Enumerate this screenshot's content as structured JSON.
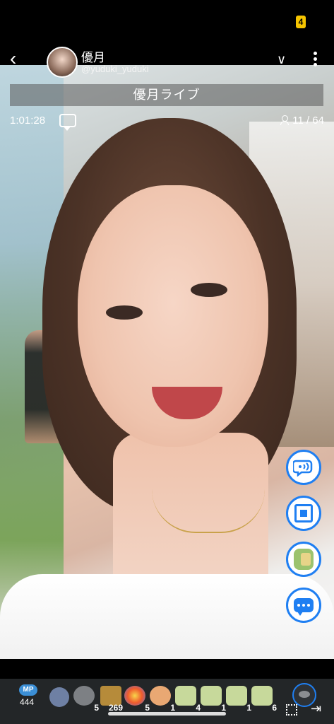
{
  "host": {
    "name": "優月",
    "id": "@yuduki_yuduki"
  },
  "stream": {
    "title": "優月ライブ",
    "elapsed": "1:01:28",
    "viewers": "11 / 64"
  },
  "status": {
    "battery": "4"
  },
  "mp": {
    "label": "MP",
    "value": "444"
  },
  "items": [
    {
      "name": "stone-gift-icon",
      "count": "5"
    },
    {
      "name": "yen-gift-icon",
      "count": "269"
    },
    {
      "name": "firework-gift-icon",
      "count": "5"
    },
    {
      "name": "clap-gift-icon",
      "count": "1"
    },
    {
      "name": "green-gift-10-icon",
      "count": "4"
    },
    {
      "name": "green-gift-icon",
      "count": "1"
    },
    {
      "name": "green-gift-100-icon",
      "count": "1"
    },
    {
      "name": "green-gift-30-icon",
      "count": "6"
    }
  ],
  "icons": {
    "back": "chevron-left-icon",
    "dropdown": "chevron-down-icon",
    "more": "more-vertical-icon",
    "comment": "comment-icon",
    "viewers": "person-icon",
    "fullscreen": "expand-icon",
    "exit": "exit-icon"
  },
  "colors": {
    "accent": "#1f7ff2",
    "bottom_bar": "#232628",
    "title_bar": "#5a5a5a"
  }
}
